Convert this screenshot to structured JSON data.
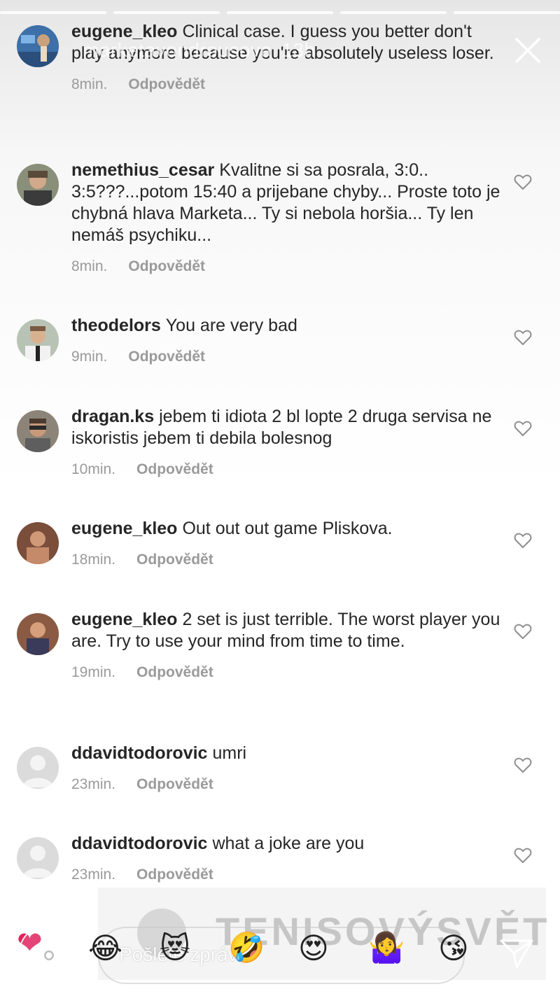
{
  "story": {
    "username": "marketavondrousova",
    "time": "13h"
  },
  "comments": [
    {
      "user": "eugene_kleo",
      "text": "Clinical case. I guess you better don't play anymore because you're absolutely useless loser.",
      "time": "8min.",
      "reply": "Odpovědět"
    },
    {
      "user": "nemethius_cesar",
      "text": "Kvalitne si sa posrala, 3:0.. 3:5???...potom 15:40 a prijebane chyby... Proste toto je chybná hlava Marketa... Ty si nebola horšia... Ty len nemáš psychiku...",
      "time": "8min.",
      "reply": "Odpovědět"
    },
    {
      "user": "theodelors",
      "text": "You are very bad",
      "time": "9min.",
      "reply": "Odpovědět"
    },
    {
      "user": "dragan.ks",
      "text": "jebem ti idiota 2 bl lopte 2  druga servisa ne iskoristis jebem ti debila bolesnog",
      "time": "10min.",
      "reply": "Odpovědět"
    },
    {
      "user": "eugene_kleo",
      "text": "Out out out game Pliskova.",
      "time": "18min.",
      "reply": "Odpovědět"
    },
    {
      "user": "eugene_kleo",
      "text": "2 set is just terrible. The worst player you are. Try to use your mind from time to time.",
      "time": "19min.",
      "reply": "Odpovědět"
    },
    {
      "user": "ddavidtodorovic",
      "text": "umri",
      "time": "23min.",
      "reply": "Odpovědět"
    },
    {
      "user": "ddavidtodorovic",
      "text": "what a joke are you",
      "time": "23min.",
      "reply": "Odpovědět"
    }
  ],
  "composer": {
    "placeholder": "Pošlete zprávu"
  },
  "reactions": [
    "😂",
    "😻",
    "🤣",
    "😍",
    "🤷‍♀️",
    "😘",
    "❤"
  ],
  "watermark": "TENISOVÝSVĚT",
  "icons": {
    "close": "close-icon",
    "heart": "heart-icon",
    "camera": "camera-icon",
    "send": "send-icon"
  },
  "colors": {
    "text": "#262626",
    "meta": "#9a9a9a",
    "reaction_heart": "#e0245e"
  }
}
